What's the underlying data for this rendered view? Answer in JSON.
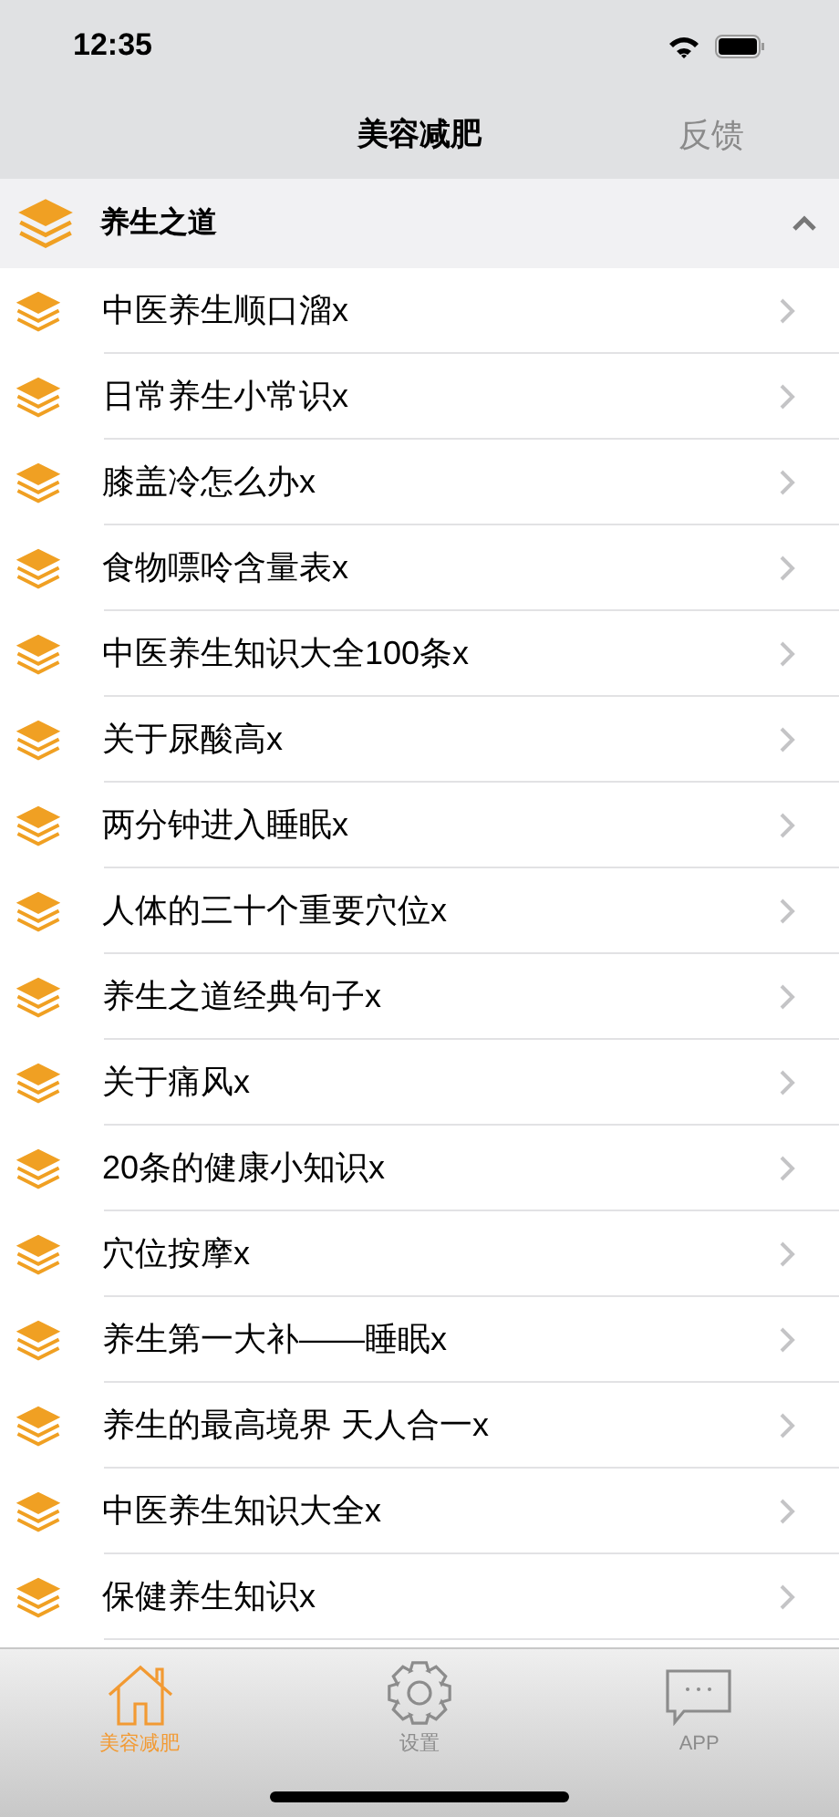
{
  "status_bar": {
    "time": "12:35"
  },
  "nav": {
    "title": "美容减肥",
    "right_button": "反馈"
  },
  "section": {
    "title": "养生之道",
    "expanded": true
  },
  "items": [
    {
      "title": "中医养生顺口溜x"
    },
    {
      "title": "日常养生小常识x"
    },
    {
      "title": "膝盖冷怎么办x"
    },
    {
      "title": "食物嘌呤含量表x"
    },
    {
      "title": "中医养生知识大全100条x"
    },
    {
      "title": "关于尿酸高x"
    },
    {
      "title": "两分钟进入睡眠x"
    },
    {
      "title": "人体的三十个重要穴位x"
    },
    {
      "title": "养生之道经典句子x"
    },
    {
      "title": "关于痛风x"
    },
    {
      "title": "20条的健康小知识x"
    },
    {
      "title": "穴位按摩x"
    },
    {
      "title": "养生第一大补——睡眠x"
    },
    {
      "title": "养生的最高境界 天人合一x"
    },
    {
      "title": "中医养生知识大全x"
    },
    {
      "title": "保健养生知识x"
    }
  ],
  "tab_bar": [
    {
      "kind": "home",
      "label": "美容减肥",
      "selected": true
    },
    {
      "kind": "settings",
      "label": "设置",
      "selected": false
    },
    {
      "kind": "chat",
      "label": "APP",
      "selected": false
    }
  ]
}
